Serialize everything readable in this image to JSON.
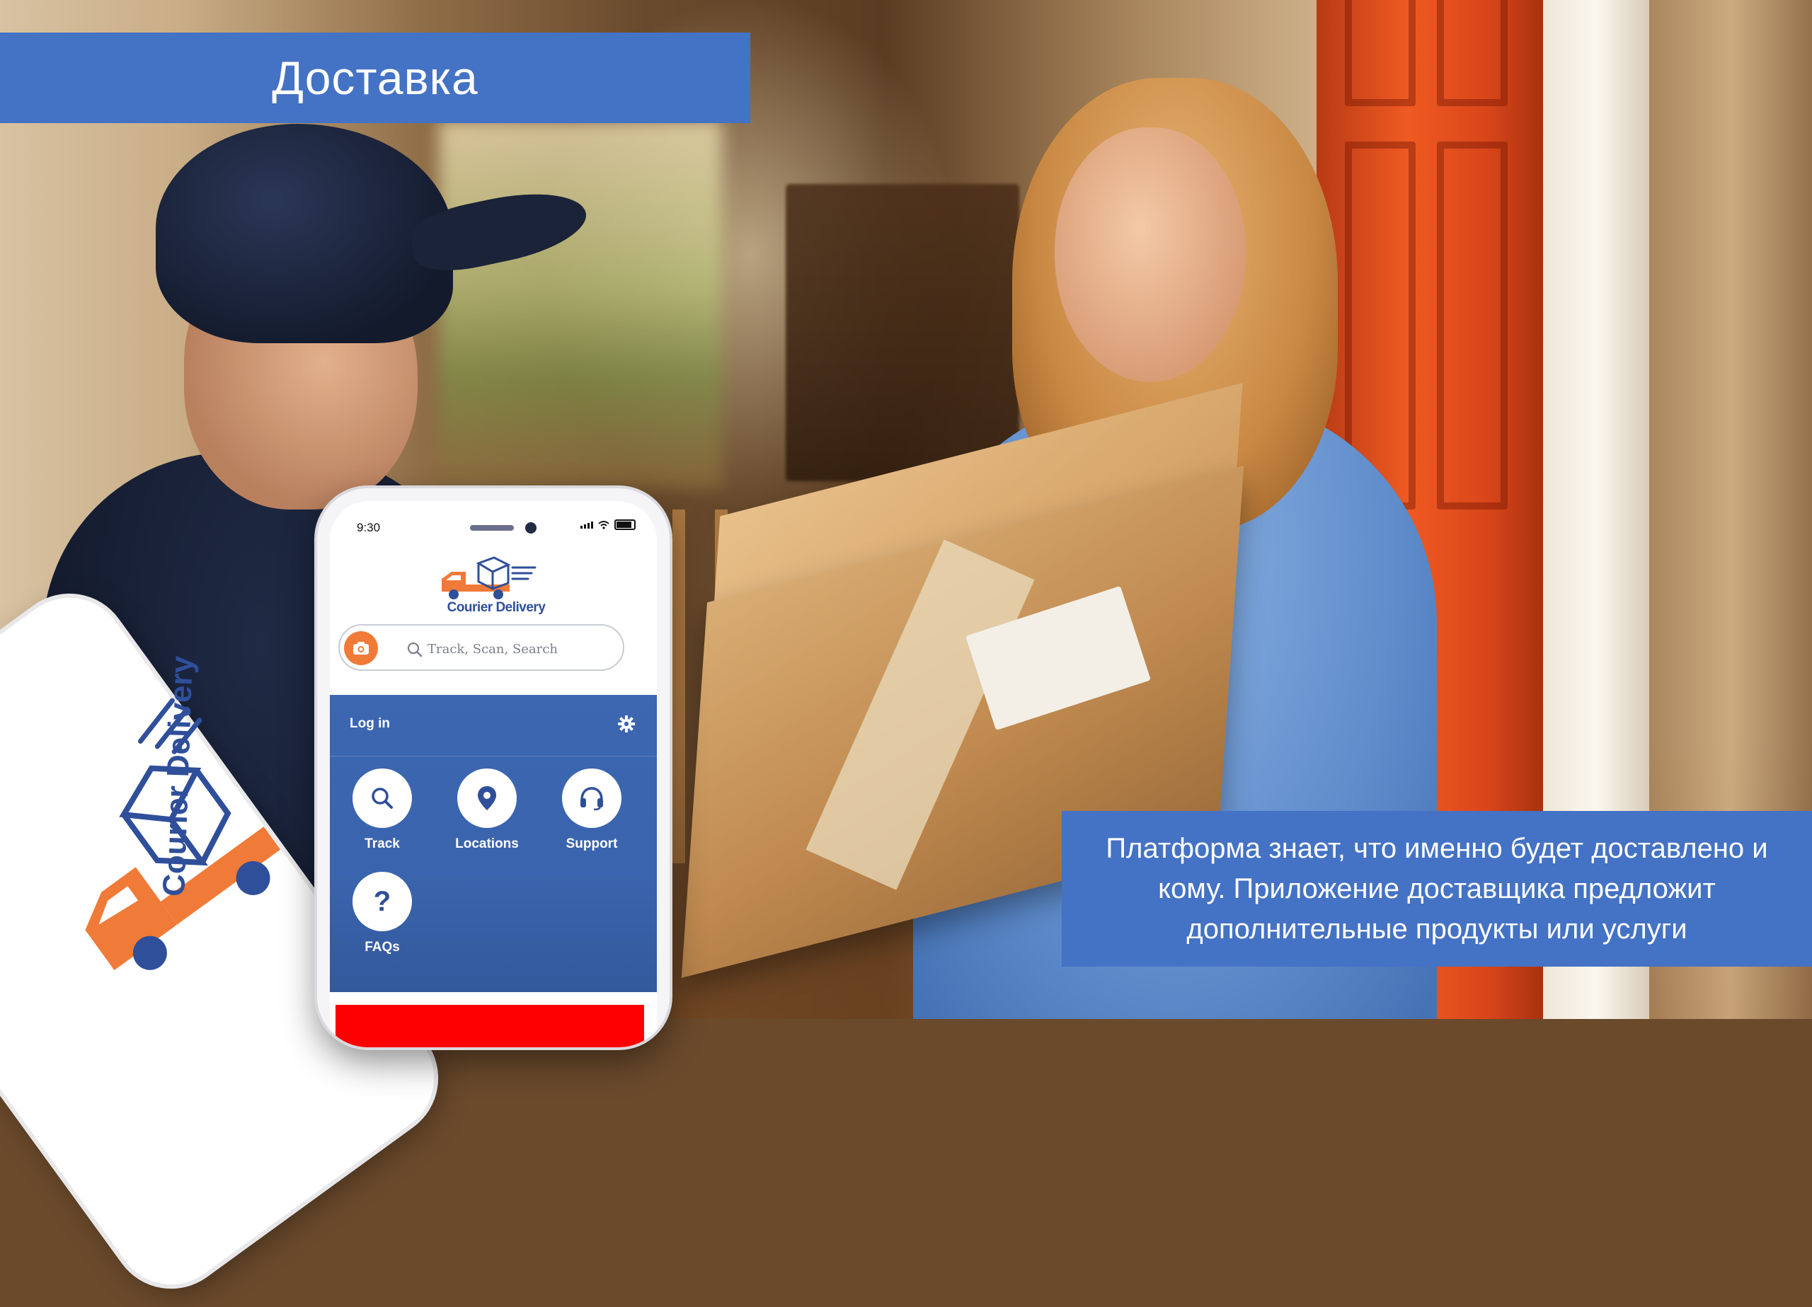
{
  "slide": {
    "title": "Доставка",
    "caption": "Платформа знает, что именно будет доставлено и кому. Приложение доставщика предложит дополнительные продукты или услуги"
  },
  "colors": {
    "accent_blue": "#4472c4",
    "app_panel_blue": "#3c67b1",
    "camera_orange": "#f07a37",
    "brand_navy": "#2f4f9a",
    "alert_red": "#ff0000"
  },
  "phone": {
    "status_time": "9:30",
    "brand_name": "Courier Delivery",
    "search": {
      "placeholder": "Track, Scan, Search",
      "value": ""
    },
    "panel": {
      "login_label": "Log in"
    },
    "tiles": [
      {
        "label": "Track",
        "icon": "search-icon"
      },
      {
        "label": "Locations",
        "icon": "location-pin-icon"
      },
      {
        "label": "Support",
        "icon": "headset-icon"
      },
      {
        "label": "FAQs",
        "icon": "question-icon"
      }
    ],
    "faq_symbol": "?"
  },
  "tilted_phone": {
    "brand_name": "Courier Delivery"
  }
}
